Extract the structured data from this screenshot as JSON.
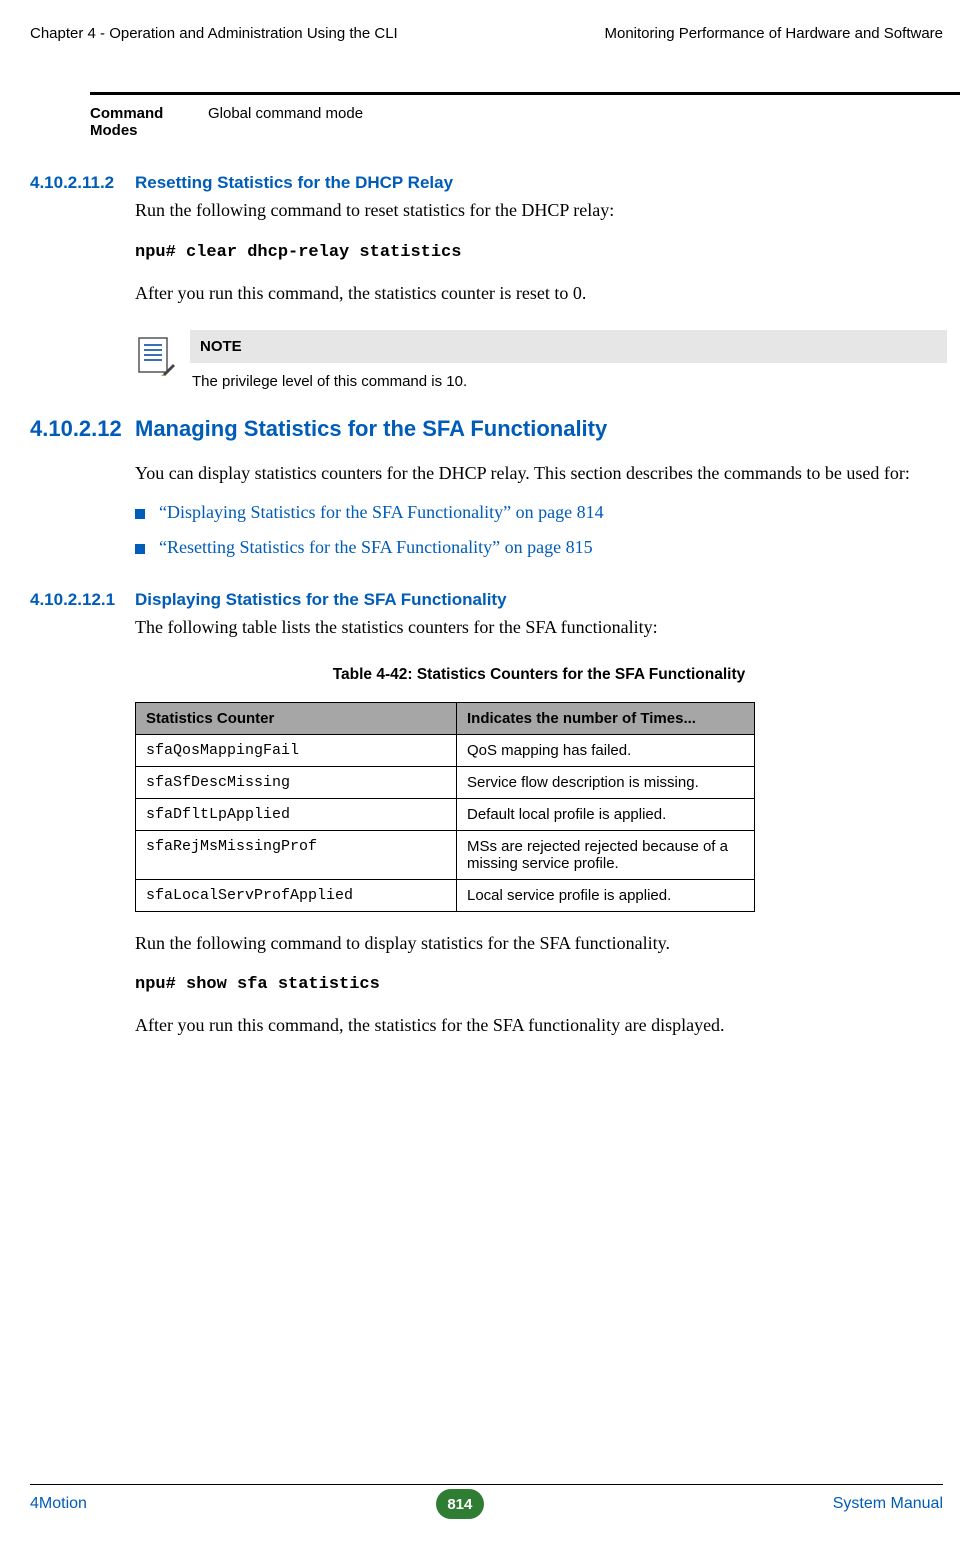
{
  "header": {
    "left": "Chapter 4 - Operation and Administration Using the CLI",
    "right": "Monitoring Performance of Hardware and Software"
  },
  "cmd_modes": {
    "label_line1": "Command",
    "label_line2": "Modes",
    "value": "Global command mode"
  },
  "sec1": {
    "num": "4.10.2.11.2",
    "title": "Resetting Statistics for the DHCP Relay",
    "p1": "Run the following command to reset statistics for the DHCP relay:",
    "cmd": "npu# clear dhcp-relay statistics",
    "p2": "After you run this command, the statistics counter is reset to 0."
  },
  "note": {
    "head": "NOTE",
    "body": "The privilege level of this command is 10."
  },
  "sec2": {
    "num": "4.10.2.12",
    "title": "Managing Statistics for the SFA Functionality",
    "p1": "You can display statistics counters for the DHCP relay. This section describes the commands to be used for:",
    "bullets": [
      "“Displaying Statistics for the SFA Functionality” on page 814",
      "“Resetting Statistics for the SFA Functionality” on page 815"
    ]
  },
  "sec3": {
    "num": "4.10.2.12.1",
    "title": "Displaying Statistics for the SFA Functionality",
    "p1": "The following table lists the statistics counters for the SFA functionality:",
    "table_caption": "Table 4-42: Statistics Counters for the SFA Functionality",
    "th1": "Statistics Counter",
    "th2": "Indicates the number of Times...",
    "rows": [
      {
        "c": "sfaQosMappingFail",
        "d": "QoS mapping has failed."
      },
      {
        "c": "sfaSfDescMissing",
        "d": "Service flow description is missing."
      },
      {
        "c": "sfaDfltLpApplied",
        "d": "Default local profile is applied."
      },
      {
        "c": "sfaRejMsMissingProf",
        "d": "MSs are rejected rejected because of a missing service profile."
      },
      {
        "c": "sfaLocalServProfApplied",
        "d": "Local service profile is applied."
      }
    ],
    "p2": "Run the following command to display statistics for the SFA functionality.",
    "cmd": "npu# show sfa statistics",
    "p3": "After you run this command, the statistics for the SFA functionality are displayed."
  },
  "footer": {
    "left": "4Motion",
    "page": "814",
    "right": "System Manual"
  }
}
